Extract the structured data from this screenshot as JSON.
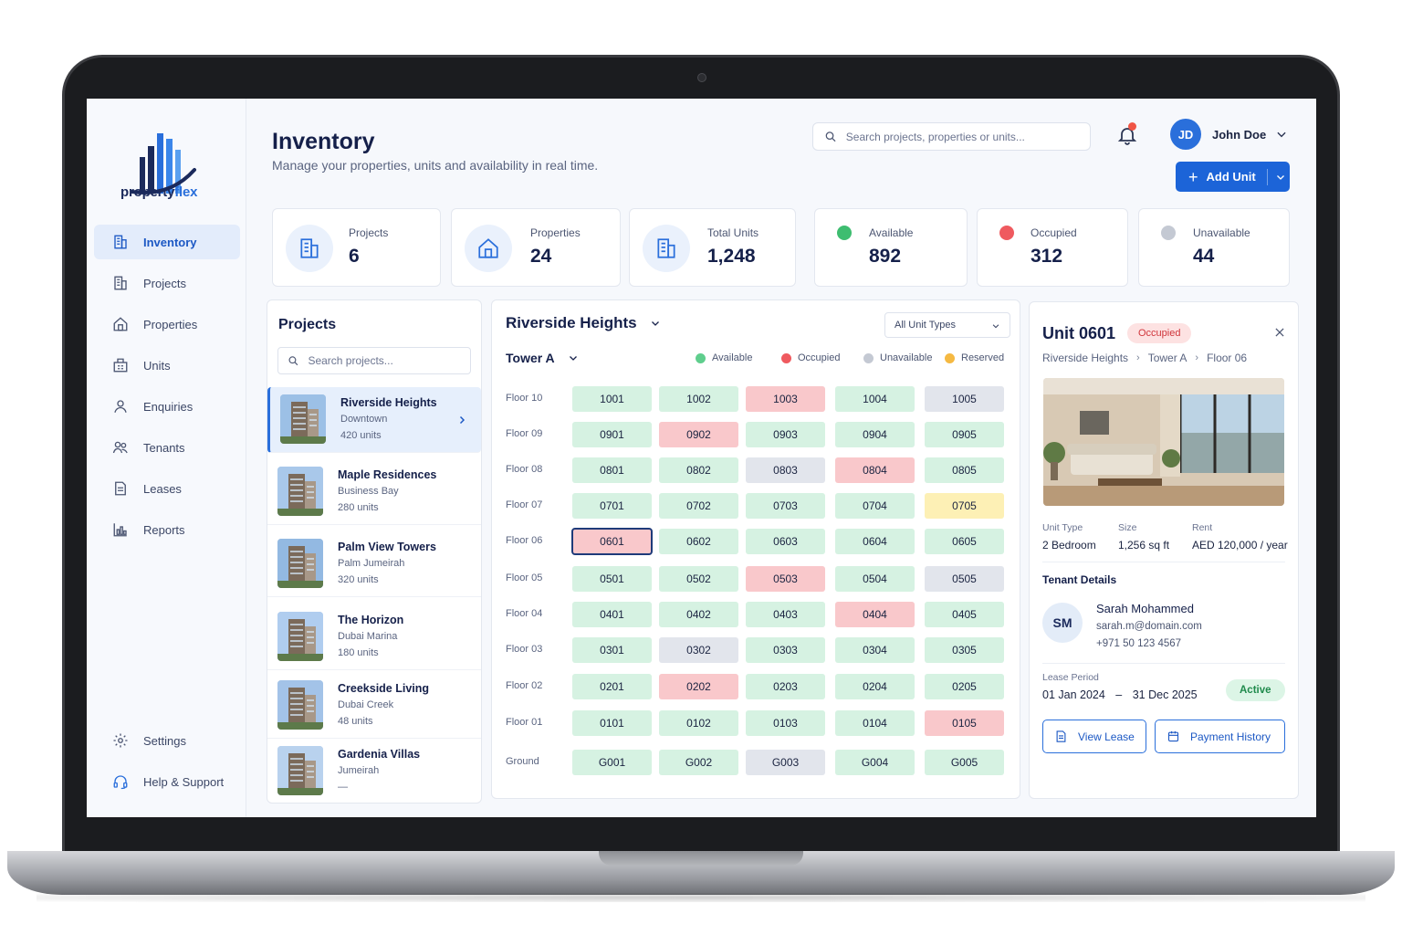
{
  "brand": {
    "name_part1": "property",
    "name_part2": "flex"
  },
  "nav": {
    "items": [
      {
        "label": "Inventory",
        "icon": "building-icon"
      },
      {
        "label": "Projects",
        "icon": "office-icon"
      },
      {
        "label": "Properties",
        "icon": "house-icon"
      },
      {
        "label": "Units",
        "icon": "units-icon"
      },
      {
        "label": "Enquiries",
        "icon": "user-icon"
      },
      {
        "label": "Tenants",
        "icon": "users-icon"
      },
      {
        "label": "Leases",
        "icon": "document-icon"
      },
      {
        "label": "Reports",
        "icon": "chart-icon"
      }
    ],
    "bottom": [
      {
        "label": "Settings",
        "icon": "gear-icon"
      },
      {
        "label": "Help & Support",
        "icon": "headset-icon"
      }
    ]
  },
  "header": {
    "title": "Inventory",
    "subtitle": "Manage your properties, units and availability in real time.",
    "search_placeholder": "Search projects, properties or units...",
    "user_initials": "JD",
    "user_name": "John Doe",
    "add_label": "Add Unit"
  },
  "stats": [
    {
      "label": "Projects",
      "value": "6"
    },
    {
      "label": "Properties",
      "value": "24"
    },
    {
      "label": "Total Units",
      "value": "1,248"
    },
    {
      "label": "Available",
      "value": "892",
      "color": "#3ebd70"
    },
    {
      "label": "Occupied",
      "value": "312",
      "color": "#ef5a5f"
    },
    {
      "label": "Unavailable",
      "value": "44",
      "color": "#c4c9d3"
    }
  ],
  "projects": {
    "title": "Projects",
    "search_placeholder": "Search projects...",
    "items": [
      {
        "name": "Riverside Heights",
        "location": "Downtown",
        "units": "420 units"
      },
      {
        "name": "Maple Residences",
        "location": "Business Bay",
        "units": "280 units"
      },
      {
        "name": "Palm View Towers",
        "location": "Palm Jumeirah",
        "units": "320 units"
      },
      {
        "name": "The Horizon",
        "location": "Dubai Marina",
        "units": "180 units"
      },
      {
        "name": "Creekside Living",
        "location": "Dubai Creek",
        "units": "48 units"
      },
      {
        "name": "Gardenia Villas",
        "location": "Jumeirah",
        "units": "—"
      }
    ]
  },
  "grid": {
    "project": "Riverside Heights",
    "unit_type": "All Unit Types",
    "tower": "Tower A",
    "legend": [
      {
        "label": "Available",
        "color": "#5fce8d"
      },
      {
        "label": "Occupied",
        "color": "#ef5a5f"
      },
      {
        "label": "Unavailable",
        "color": "#c4c9d3"
      },
      {
        "label": "Reserved",
        "color": "#f5b942"
      }
    ],
    "floors": [
      {
        "label": "Floor 10",
        "units": [
          [
            "1001",
            "available"
          ],
          [
            "1002",
            "available"
          ],
          [
            "1003",
            "occupied"
          ],
          [
            "1004",
            "available"
          ],
          [
            "1005",
            "unavailable"
          ]
        ]
      },
      {
        "label": "Floor 09",
        "units": [
          [
            "0901",
            "available"
          ],
          [
            "0902",
            "occupied"
          ],
          [
            "0903",
            "available"
          ],
          [
            "0904",
            "available"
          ],
          [
            "0905",
            "available"
          ]
        ]
      },
      {
        "label": "Floor 08",
        "units": [
          [
            "0801",
            "available"
          ],
          [
            "0802",
            "available"
          ],
          [
            "0803",
            "unavailable"
          ],
          [
            "0804",
            "occupied"
          ],
          [
            "0805",
            "available"
          ]
        ]
      },
      {
        "label": "Floor 07",
        "units": [
          [
            "0701",
            "available"
          ],
          [
            "0702",
            "available"
          ],
          [
            "0703",
            "available"
          ],
          [
            "0704",
            "available"
          ],
          [
            "0705",
            "reserved"
          ]
        ]
      },
      {
        "label": "Floor 06",
        "units": [
          [
            "0601",
            "selected"
          ],
          [
            "0602",
            "available"
          ],
          [
            "0603",
            "available"
          ],
          [
            "0604",
            "available"
          ],
          [
            "0605",
            "available"
          ]
        ]
      },
      {
        "label": "Floor 05",
        "units": [
          [
            "0501",
            "available"
          ],
          [
            "0502",
            "available"
          ],
          [
            "0503",
            "occupied"
          ],
          [
            "0504",
            "available"
          ],
          [
            "0505",
            "unavailable"
          ]
        ]
      },
      {
        "label": "Floor 04",
        "units": [
          [
            "0401",
            "available"
          ],
          [
            "0402",
            "available"
          ],
          [
            "0403",
            "available"
          ],
          [
            "0404",
            "occupied"
          ],
          [
            "0405",
            "available"
          ]
        ]
      },
      {
        "label": "Floor 03",
        "units": [
          [
            "0301",
            "available"
          ],
          [
            "0302",
            "unavailable"
          ],
          [
            "0303",
            "available"
          ],
          [
            "0304",
            "available"
          ],
          [
            "0305",
            "available"
          ]
        ]
      },
      {
        "label": "Floor 02",
        "units": [
          [
            "0201",
            "available"
          ],
          [
            "0202",
            "occupied"
          ],
          [
            "0203",
            "available"
          ],
          [
            "0204",
            "available"
          ],
          [
            "0205",
            "available"
          ]
        ]
      },
      {
        "label": "Floor 01",
        "units": [
          [
            "0101",
            "available"
          ],
          [
            "0102",
            "available"
          ],
          [
            "0103",
            "available"
          ],
          [
            "0104",
            "available"
          ],
          [
            "0105",
            "occupied"
          ]
        ]
      },
      {
        "label": "Ground",
        "units": [
          [
            "G001",
            "available"
          ],
          [
            "G002",
            "available"
          ],
          [
            "G003",
            "unavailable"
          ],
          [
            "G004",
            "available"
          ],
          [
            "G005",
            "available"
          ]
        ]
      }
    ]
  },
  "detail": {
    "unit": "Unit 0601",
    "status": "Occupied",
    "crumbs": [
      "Riverside Heights",
      "Tower A",
      "Floor 06"
    ],
    "specs": [
      {
        "label": "Unit Type",
        "value": "2 Bedroom"
      },
      {
        "label": "Size",
        "value": "1,256 sq ft"
      },
      {
        "label": "Rent",
        "value": "AED 120,000 / year"
      }
    ],
    "tenant_title": "Tenant Details",
    "tenant_initials": "SM",
    "tenant_name": "Sarah Mohammed",
    "tenant_email": "sarah.m@domain.com",
    "tenant_phone": "+971 50 123 4567",
    "lease_label": "Lease Period",
    "lease_start": "01 Jan 2024",
    "lease_dash": "–",
    "lease_end": "31 Dec 2025",
    "lease_status": "Active",
    "view_lease": "View Lease",
    "payment_history": "Payment History"
  }
}
